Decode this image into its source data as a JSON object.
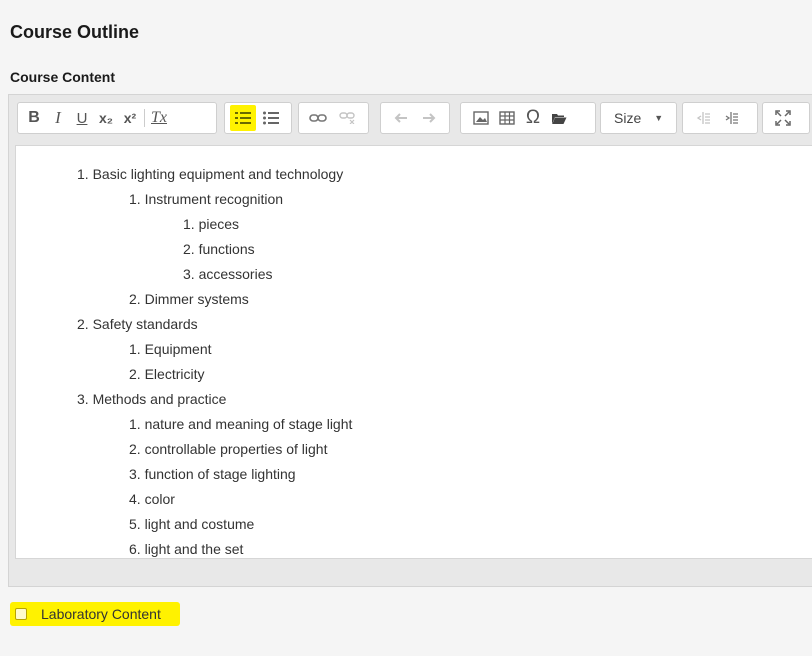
{
  "header": {
    "title": "Course Outline"
  },
  "editor": {
    "label": "Course Content",
    "toolbar": {
      "bold": "B",
      "italic": "I",
      "underline": "U",
      "subscript": "x₂",
      "superscript": "x²",
      "remove_format": "Tx",
      "size_label": "Size"
    },
    "outline": [
      {
        "level": 1,
        "number": "1.",
        "text": "Basic lighting equipment and technology"
      },
      {
        "level": 2,
        "number": "1.",
        "text": "Instrument recognition"
      },
      {
        "level": 3,
        "number": "1.",
        "text": "pieces"
      },
      {
        "level": 3,
        "number": "2.",
        "text": "functions"
      },
      {
        "level": 3,
        "number": "3.",
        "text": "accessories"
      },
      {
        "level": 2,
        "number": "2.",
        "text": "Dimmer systems"
      },
      {
        "level": 1,
        "number": "2.",
        "text": "Safety standards"
      },
      {
        "level": 2,
        "number": "1.",
        "text": "Equipment"
      },
      {
        "level": 2,
        "number": "2.",
        "text": "Electricity"
      },
      {
        "level": 1,
        "number": "3.",
        "text": "Methods and practice"
      },
      {
        "level": 2,
        "number": "1.",
        "text": "nature and meaning of stage light"
      },
      {
        "level": 2,
        "number": "2.",
        "text": "controllable properties of light"
      },
      {
        "level": 2,
        "number": "3.",
        "text": "function of stage lighting"
      },
      {
        "level": 2,
        "number": "4.",
        "text": "color"
      },
      {
        "level": 2,
        "number": "5.",
        "text": "light and costume"
      },
      {
        "level": 2,
        "number": "6.",
        "text": "light and the set"
      }
    ]
  },
  "laboratory": {
    "label": "Laboratory Content",
    "checked": false
  },
  "colors": {
    "highlight": "#fff200",
    "background": "#f5f5f5"
  }
}
